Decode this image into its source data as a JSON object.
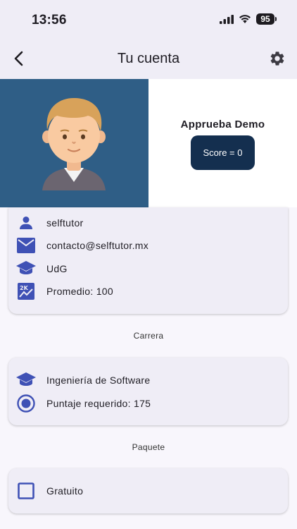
{
  "status": {
    "time": "13:56",
    "battery": "95"
  },
  "header": {
    "title": "Tu cuenta"
  },
  "profile": {
    "name": "Apprueba Demo",
    "score_label": "Score = 0"
  },
  "user_info": {
    "username": "selftutor",
    "email": "contacto@selftutor.mx",
    "school": "UdG",
    "average": "Promedio: 100"
  },
  "career": {
    "title": "Carrera",
    "name": "Ingeniería de Software",
    "required_score": "Puntaje requerido: 175"
  },
  "package": {
    "title": "Paquete",
    "name": "Gratuito"
  },
  "colors": {
    "accent": "#3f51b5",
    "avatar_bg": "#2f5e86",
    "score_btn": "#142f4f"
  }
}
